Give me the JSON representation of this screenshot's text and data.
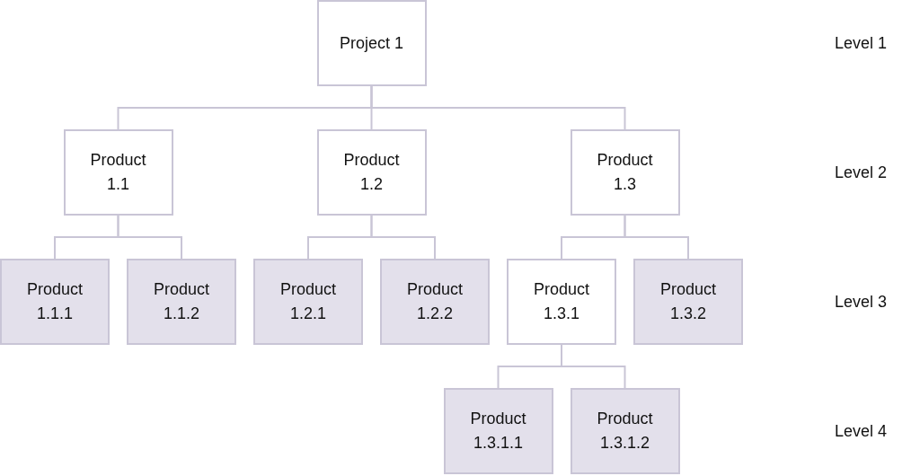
{
  "tree": {
    "label": "Project 1",
    "color": "#ffffff",
    "children": [
      {
        "label": "Product 1.1",
        "color": "#ffffff",
        "children": [
          {
            "label": "Product 1.1.1",
            "color": "#e3e0eb"
          },
          {
            "label": "Product 1.1.2",
            "color": "#e3e0eb"
          }
        ]
      },
      {
        "label": "Product 1.2",
        "color": "#ffffff",
        "children": [
          {
            "label": "Product 1.2.1",
            "color": "#e3e0eb"
          },
          {
            "label": "Product 1.2.2",
            "color": "#e3e0eb"
          }
        ]
      },
      {
        "label": "Product 1.3",
        "color": "#ffffff",
        "children": [
          {
            "label": "Product 1.3.1",
            "color": "#ffffff",
            "children": [
              {
                "label": "Product 1.3.1.1",
                "color": "#e3e0eb"
              },
              {
                "label": "Product 1.3.1.2",
                "color": "#e3e0eb"
              }
            ]
          },
          {
            "label": "Product 1.3.2",
            "color": "#e3e0eb"
          }
        ]
      }
    ]
  },
  "levels": [
    "Level 1",
    "Level 2",
    "Level 3",
    "Level 4"
  ]
}
